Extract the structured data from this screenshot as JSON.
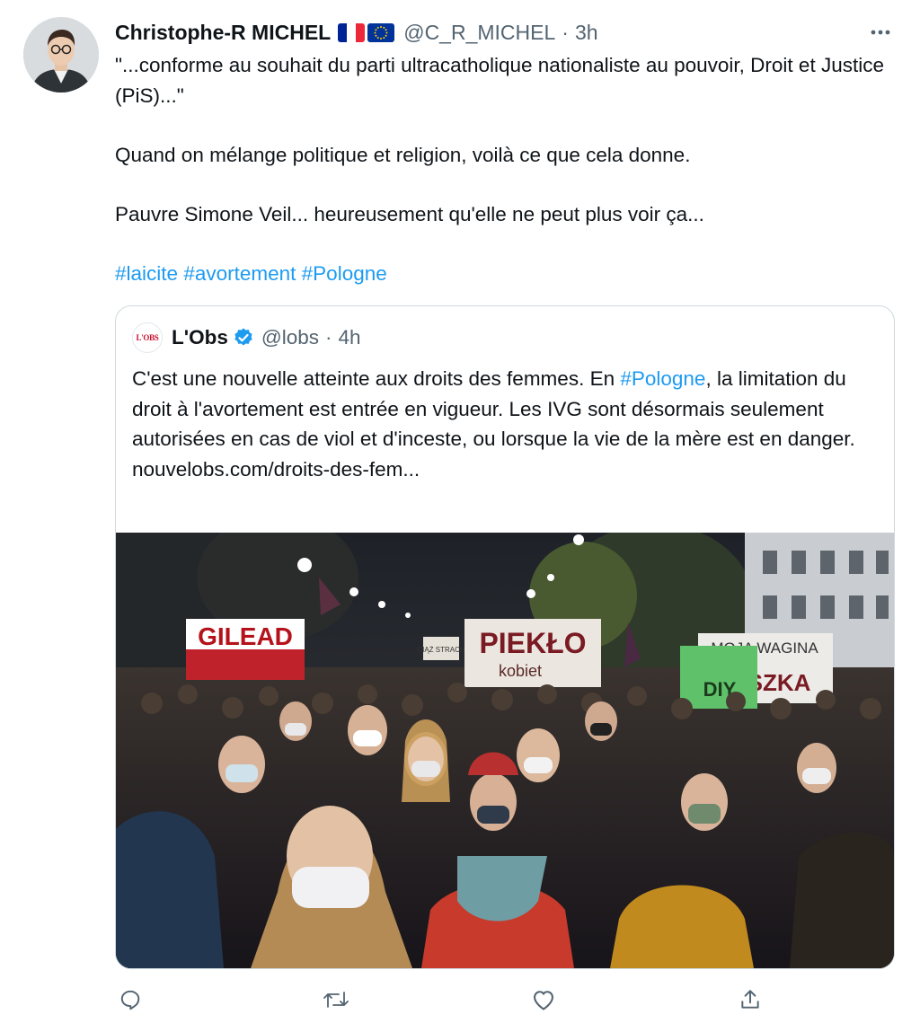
{
  "author": {
    "name": "Christophe-R MICHEL",
    "handle": "@C_R_MICHEL",
    "separator": "·",
    "time": "3h",
    "flags": [
      "france-flag-icon",
      "eu-flag-icon"
    ]
  },
  "tweet": {
    "paragraph_1": "\"...conforme au souhait du parti ultracatholique nationaliste au pouvoir, Droit et Justice (PiS)...\"",
    "paragraph_2": "Quand on mélange politique et religion, voilà ce que cela donne.",
    "paragraph_3": "Pauvre Simone Veil... heureusement qu'elle ne peut plus voir ça...",
    "hashtags": [
      "#laicite",
      "#avortement",
      "#Pologne"
    ]
  },
  "quoted_tweet": {
    "avatar_text": "L'OBS",
    "name": "L'Obs",
    "handle": "@lobs",
    "separator": "·",
    "time": "4h",
    "text_1": "C'est une nouvelle atteinte aux droits des femmes. En ",
    "hashtag": "#Pologne",
    "text_2": ", la limitation du droit à l'avortement est entrée en vigueur. Les IVG sont désormais seulement autorisées en cas de viol et d'inceste, ou lorsque la vie de la mère est en danger.",
    "link": "nouvelobs.com/droits-des-fem...",
    "photo": {
      "signs": {
        "gilead": "GILEAD",
        "pieklo": "PIEKŁO",
        "pieklo_sub": "kobiet",
        "wagina": "MOJA WAGINA",
        "wagina_sub": "SZKA",
        "diy": "DIY",
        "strach": "CIĄŻ STRACH"
      }
    }
  },
  "actions": [
    "reply-icon",
    "retweet-icon",
    "like-icon",
    "share-icon"
  ],
  "colors": {
    "accent": "#1d9bf0",
    "text": "#0f1419",
    "muted": "#536471",
    "border": "#cfd9de"
  }
}
